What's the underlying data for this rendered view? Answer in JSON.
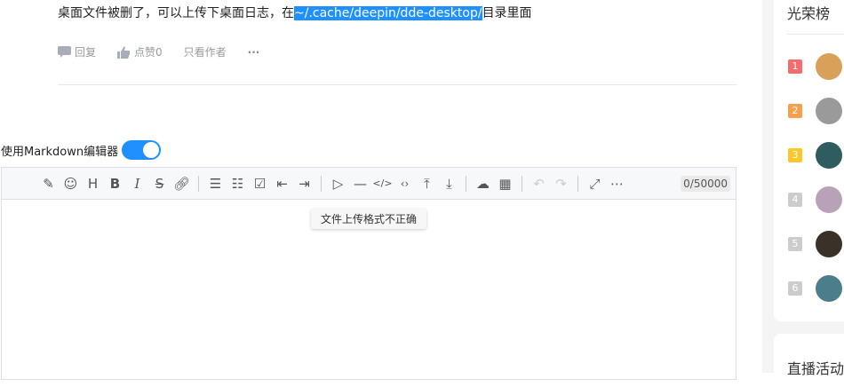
{
  "reply": {
    "text_before": "桌面文件被删了，可以上传下桌面日志，在",
    "selected": "~/.cache/deepin/dde-desktop/",
    "text_after": "目录里面"
  },
  "actions": {
    "reply": "回复",
    "like": "点赞0",
    "author_only": "只看作者",
    "more": "···"
  },
  "editor": {
    "markdown_label": "使用Markdown编辑器",
    "markdown_enabled": true,
    "count": "0/50000",
    "tooltip": "文件上传格式不正确"
  },
  "sidebar": {
    "title": "光荣榜",
    "ranks": [
      {
        "n": "1",
        "color": "#f56c6c",
        "avatar": "#d9a05a"
      },
      {
        "n": "2",
        "color": "#f7a04b",
        "avatar": "#9a9a9a"
      },
      {
        "n": "3",
        "color": "#fcc72a",
        "avatar": "#2f5c5e"
      },
      {
        "n": "4",
        "color": "#cccccc",
        "avatar": "#b9a2b8"
      },
      {
        "n": "5",
        "color": "#cccccc",
        "avatar": "#3a3128"
      },
      {
        "n": "6",
        "color": "#cccccc",
        "avatar": "#4c7d8a"
      }
    ],
    "live_title": "直播活动"
  }
}
